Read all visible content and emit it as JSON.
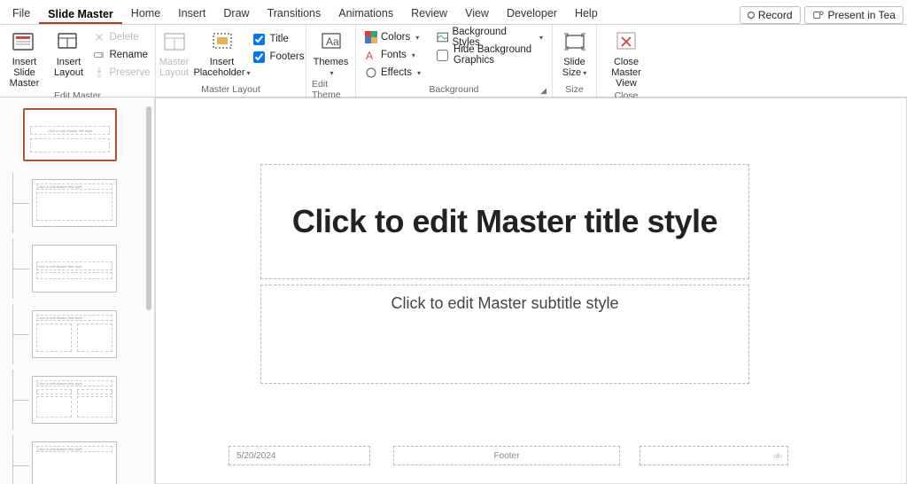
{
  "tabs": {
    "file": "File",
    "slide_master": "Slide Master",
    "home": "Home",
    "insert": "Insert",
    "draw": "Draw",
    "transitions": "Transitions",
    "animations": "Animations",
    "review": "Review",
    "view": "View",
    "developer": "Developer",
    "help": "Help"
  },
  "titlebar": {
    "record": "Record",
    "present": "Present in Tea"
  },
  "ribbon": {
    "edit_master": {
      "label": "Edit Master",
      "insert_slide_master": "Insert Slide Master",
      "insert_layout": "Insert Layout",
      "delete": "Delete",
      "rename": "Rename",
      "preserve": "Preserve"
    },
    "master_layout": {
      "label": "Master Layout",
      "master_layout_btn": "Master Layout",
      "insert_placeholder": "Insert Placeholder",
      "title_chk": "Title",
      "footers_chk": "Footers"
    },
    "edit_theme": {
      "label": "Edit Theme",
      "themes": "Themes"
    },
    "background": {
      "label": "Background",
      "colors": "Colors",
      "fonts": "Fonts",
      "effects": "Effects",
      "bg_styles": "Background Styles",
      "hide_bg": "Hide Background Graphics"
    },
    "size": {
      "label": "Size",
      "slide_size": "Slide Size"
    },
    "close": {
      "label": "Close",
      "close_master": "Close Master View"
    }
  },
  "canvas": {
    "title": "Click to edit Master title style",
    "subtitle": "Click to edit Master subtitle style",
    "date": "5/20/2024",
    "footer": "Footer",
    "slidenum": "‹#›"
  },
  "thumbs": {
    "tiny_title": "Click to edit Master title style"
  }
}
